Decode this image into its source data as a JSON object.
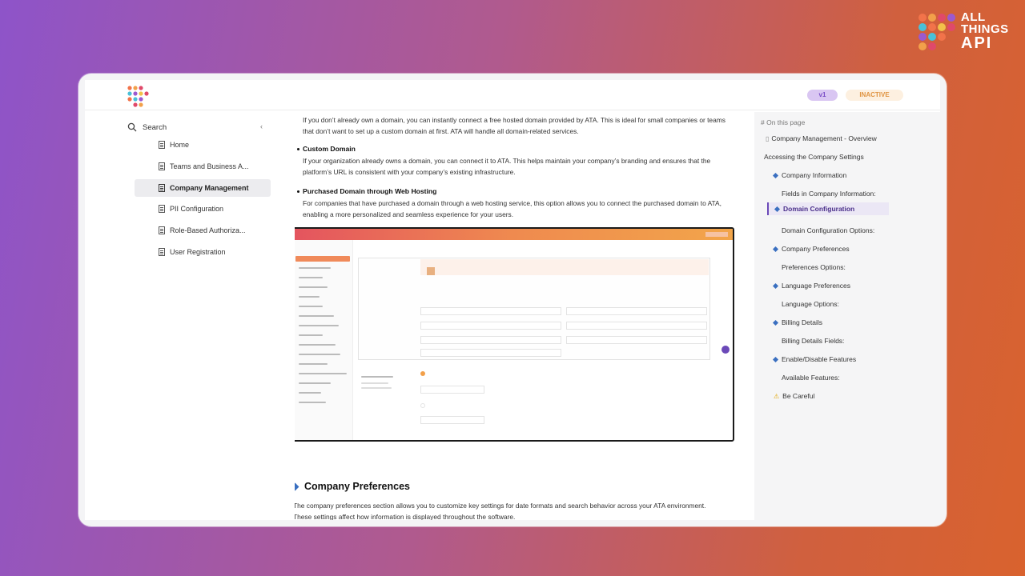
{
  "brand": {
    "line1": "ALL",
    "line2": "THINGS",
    "line3": "API"
  },
  "header": {
    "version_badge": "v1",
    "status_badge": "INACTIVE"
  },
  "sidebar": {
    "search_label": "Search",
    "items": [
      {
        "label": "Home"
      },
      {
        "label": "Teams and Business A..."
      },
      {
        "label": "Company Management"
      },
      {
        "label": "PII Configuration"
      },
      {
        "label": "Role-Based Authoriza..."
      },
      {
        "label": "User Registration"
      }
    ]
  },
  "main": {
    "intro": "If you don’t already own a domain, you can instantly connect a free hosted domain provided by ATA. This is ideal for small companies or teams that don’t want to set up a custom domain at first. ATA will handle all domain-related services.",
    "custom_domain_title": "Custom Domain",
    "custom_domain_text": "If your organization already owns a domain, you can connect it to ATA. This helps maintain your company’s branding and ensures that the platform’s URL is consistent with your company’s existing infrastructure.",
    "purchased_title": "Purchased Domain through Web Hosting",
    "purchased_text": "For companies that have purchased a domain through a web hosting service, this option allows you to connect the purchased domain to ATA, enabling a more personalized and seamless experience for your users.",
    "section_title": "Company Preferences",
    "section_text": "The company preferences section allows you to customize key settings for date formats and search behavior across your ATA environment.",
    "section_text2": "These settings affect how information is displayed throughout the software."
  },
  "toc": {
    "heading": "On this page",
    "items": [
      {
        "label": "Company Management - Overview"
      },
      {
        "label": "Accessing the Company Settings"
      },
      {
        "label": "Company Information"
      },
      {
        "label": "Fields in Company Information:"
      },
      {
        "label": "Domain Configuration"
      },
      {
        "label": "Domain Configuration Options:"
      },
      {
        "label": "Company Preferences"
      },
      {
        "label": "Preferences Options:"
      },
      {
        "label": "Language Preferences"
      },
      {
        "label": "Language Options:"
      },
      {
        "label": "Billing Details"
      },
      {
        "label": "Billing Details Fields:"
      },
      {
        "label": "Enable/Disable Features"
      },
      {
        "label": "Available Features:"
      },
      {
        "label": "Be Careful"
      }
    ]
  },
  "colors": {
    "accent": "#6b49b8",
    "diamond": "#3a6fc0",
    "status": "#e09442"
  }
}
